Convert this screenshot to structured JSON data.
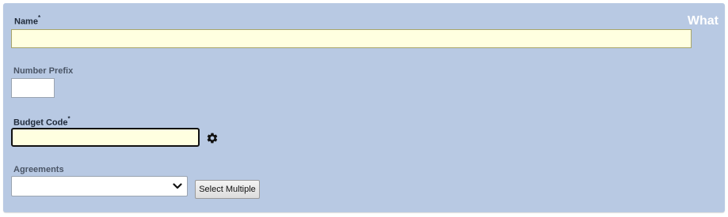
{
  "section": {
    "title": "What"
  },
  "fields": {
    "name": {
      "label": "Name",
      "required_marker": "*",
      "value": ""
    },
    "number_prefix": {
      "label": "Number Prefix",
      "value": ""
    },
    "budget_code": {
      "label": "Budget Code",
      "required_marker": "*",
      "value": ""
    },
    "agreements": {
      "label": "Agreements",
      "selected": "",
      "button_label": "Select Multiple"
    }
  },
  "icons": {
    "budget_settings": "gear-icon",
    "dropdown": "chevron-down-icon"
  },
  "colors": {
    "panel_bg": "#b8c9e3",
    "required_input_bg": "#ffffe0",
    "section_title": "#ffffff"
  }
}
